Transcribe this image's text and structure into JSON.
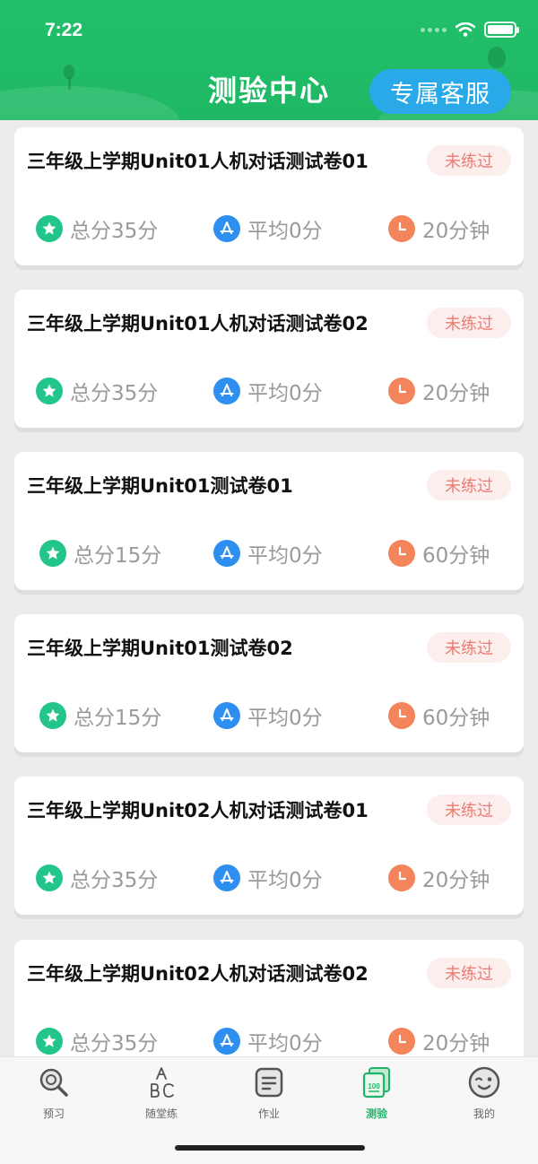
{
  "status_bar": {
    "time": "7:22"
  },
  "header": {
    "title": "测验中心",
    "service_button": "专属客服"
  },
  "cards": [
    {
      "title": "三年级上学期Unit01人机对话测试卷01",
      "badge": "未练过",
      "total": "总分35分",
      "average": "平均0分",
      "duration": "20分钟"
    },
    {
      "title": "三年级上学期Unit01人机对话测试卷02",
      "badge": "未练过",
      "total": "总分35分",
      "average": "平均0分",
      "duration": "20分钟"
    },
    {
      "title": "三年级上学期Unit01测试卷01",
      "badge": "未练过",
      "total": "总分15分",
      "average": "平均0分",
      "duration": "60分钟"
    },
    {
      "title": "三年级上学期Unit01测试卷02",
      "badge": "未练过",
      "total": "总分15分",
      "average": "平均0分",
      "duration": "60分钟"
    },
    {
      "title": "三年级上学期Unit02人机对话测试卷01",
      "badge": "未练过",
      "total": "总分35分",
      "average": "平均0分",
      "duration": "20分钟"
    },
    {
      "title": "三年级上学期Unit02人机对话测试卷02",
      "badge": "未练过",
      "total": "总分35分",
      "average": "平均0分",
      "duration": "20分钟"
    }
  ],
  "icons": {
    "total": "star-icon",
    "average": "average-icon",
    "duration": "clock-icon"
  },
  "tabbar": {
    "items": [
      {
        "label": "预习",
        "icon": "magnifier-icon"
      },
      {
        "label": "随堂练",
        "icon": "abc-icon"
      },
      {
        "label": "作业",
        "icon": "document-icon"
      },
      {
        "label": "测验",
        "icon": "test-paper-icon",
        "active": true
      },
      {
        "label": "我的",
        "icon": "face-icon"
      }
    ]
  },
  "colors": {
    "header": "#22c06a",
    "service_button": "#29a9e8",
    "badge_text": "#ec7b72",
    "badge_bg": "#fdeeee",
    "active_tab": "#22b36a"
  }
}
